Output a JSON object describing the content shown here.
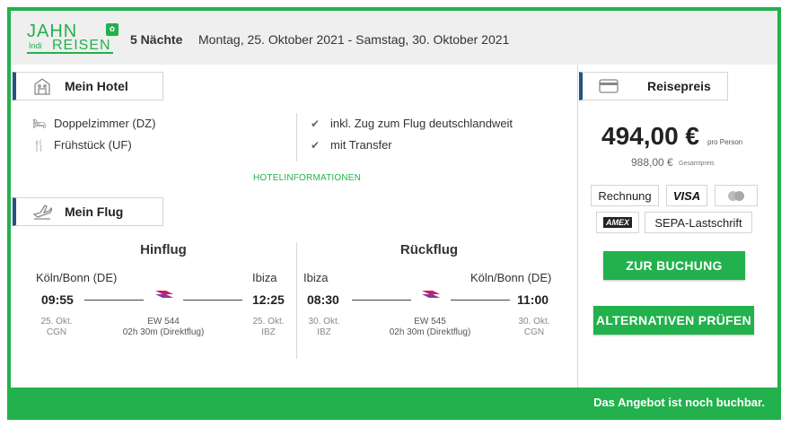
{
  "header": {
    "logo": {
      "line1": "JAHN",
      "line2": "REISEN",
      "sub": "Indi"
    },
    "nights": "5 Nächte",
    "dates": "Montag, 25. Oktober 2021 - Samstag, 30. Oktober 2021"
  },
  "hotel": {
    "tab_label": "Mein Hotel",
    "features_left": [
      {
        "icon": "bed-icon",
        "text": "Doppelzimmer (DZ)"
      },
      {
        "icon": "cutlery-icon",
        "text": "Frühstück (UF)"
      }
    ],
    "features_right": [
      {
        "icon": "check-icon",
        "text": "inkl. Zug zum Flug deutschlandweit"
      },
      {
        "icon": "check-icon",
        "text": "mit Transfer"
      }
    ],
    "info_link": "HOTELINFORMATIONEN"
  },
  "flight": {
    "tab_label": "Mein Flug",
    "outbound": {
      "title": "Hinflug",
      "from_city": "Köln/Bonn (DE)",
      "to_city": "Ibiza",
      "dep_time": "09:55",
      "arr_time": "12:25",
      "dep_date": "25. Okt.",
      "dep_code": "CGN",
      "arr_date": "25. Okt.",
      "arr_code": "IBZ",
      "flight_no": "EW 544",
      "duration": "02h 30m (Direktflug)"
    },
    "return": {
      "title": "Rückflug",
      "from_city": "Ibiza",
      "to_city": "Köln/Bonn (DE)",
      "dep_time": "08:30",
      "arr_time": "11:00",
      "dep_date": "30. Okt.",
      "dep_code": "IBZ",
      "arr_date": "30. Okt.",
      "arr_code": "CGN",
      "flight_no": "EW 545",
      "duration": "02h 30m (Direktflug)"
    }
  },
  "price": {
    "tab_label": "Reisepreis",
    "per_person": "494,00 €",
    "per_person_label": "pro Person",
    "total": "988,00 €",
    "total_label": "Gesamtpreis",
    "payments": [
      "Rechnung",
      "VISA",
      "mastercard",
      "AMEX",
      "SEPA-Lastschrift"
    ],
    "book_button": "ZUR BUCHUNG",
    "alt_button": "ALTERNATIVEN PRÜFEN"
  },
  "footer": {
    "message": "Das Angebot ist noch buchbar."
  },
  "colors": {
    "accent": "#22b14c",
    "tab_marker": "#22557f",
    "header_bg": "#efefef"
  }
}
